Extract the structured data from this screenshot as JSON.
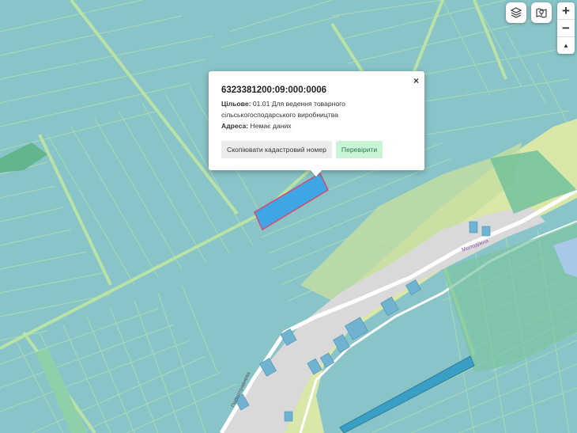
{
  "popup": {
    "cadastral_number": "6323381200:09:000:0006",
    "purpose_label": "Цільове:",
    "purpose_value": "01.01 Для ведення товарного сільськогосподарського виробництва",
    "address_label": "Адреса:",
    "address_value": "Немає даних",
    "copy_button": "Скопіювати кадастровий номер",
    "check_button": "Перевірити",
    "close_symbol": "×"
  },
  "map_controls": {
    "layers_icon": "layers-icon",
    "map_pin_icon": "map-pin-icon",
    "zoom_in": "+",
    "zoom_out": "−",
    "compass": "▲"
  },
  "street_labels": [
    "Молодіжна",
    "Першотравнева"
  ],
  "colors": {
    "parcel_fill": "#88c4c8",
    "parcel_border": "#a8d9a8",
    "selected_parcel": "#3fa6e6",
    "selected_border": "#d84a6b",
    "village_area": "#d8e6a8",
    "road_fill": "#ffffff",
    "built_area": "#d9d9d9",
    "forest": "#5fb29a"
  }
}
